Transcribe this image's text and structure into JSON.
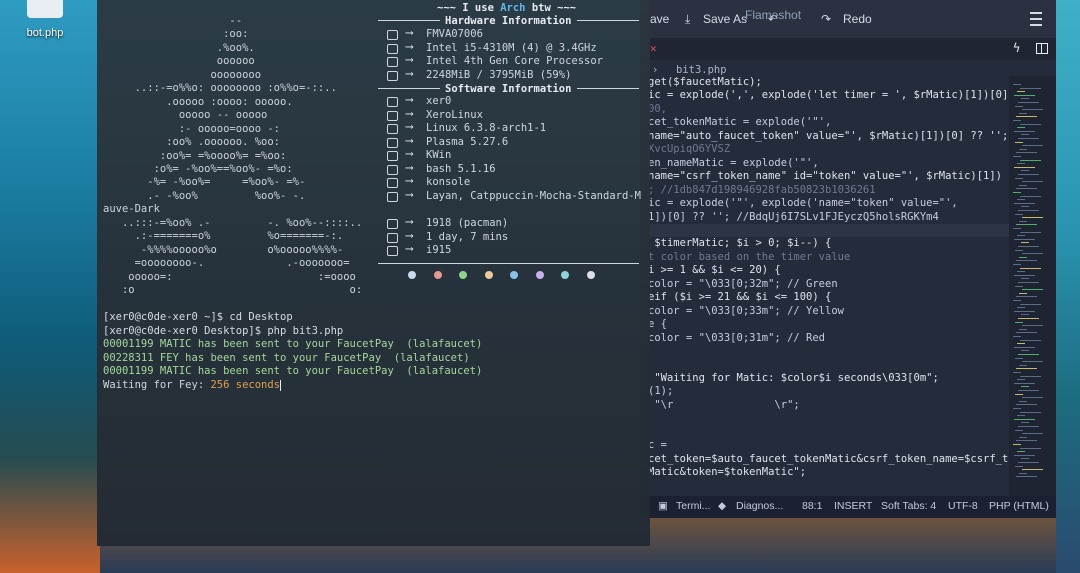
{
  "desktop": {
    "icon_label": "bot.php"
  },
  "editor": {
    "toolbar": {
      "save_partial": "ave",
      "save_as": "Save As",
      "undo_partial": "Flameshot",
      "redo": "Redo"
    },
    "breadcrumb": "bit3.php",
    "code_lines": [
      {
        "text": "get($faucetMatic);",
        "hl": false
      },
      {
        "text": "ic = explode(',', explode('let timer = ', $rMatic)[1])[0]",
        "hl": false
      },
      {
        "text": "00,",
        "hl": false
      },
      {
        "text": "cet_tokenMatic = explode('\"',",
        "hl": false
      },
      {
        "text": "name=\"auto_faucet_token\" value=\"', $rMatic)[1])[0] ?? '';",
        "hl": false
      },
      {
        "text": "XvcUpiqO6YVSZ",
        "hl": false
      },
      {
        "text": "en_nameMatic = explode('\"',",
        "hl": false
      },
      {
        "text": "name=\"csrf_token_name\" id=\"token\" value=\"', $rMatic)[1])",
        "hl": false
      },
      {
        "text": "; //1db847d198946928fab50823b1036261",
        "hl": false
      },
      {
        "text": "ic = explode('\"', explode('name=\"token\" value=\"',",
        "hl": false
      },
      {
        "text": "1])[0] ?? ''; //BdqUj6I7SLv1FJEyczQ5holsRGKYm4",
        "hl": false
      },
      {
        "text": "",
        "hl": true
      },
      {
        "text": " $timerMatic; $i > 0; $i--) {",
        "hl": false
      },
      {
        "text": "t color based on the timer value",
        "hl": false
      },
      {
        "text": "i >= 1 && $i <= 20) {",
        "hl": false
      },
      {
        "text": "color = \"\\033[0;32m\"; // Green",
        "hl": false
      },
      {
        "text": "eif ($i >= 21 && $i <= 100) {",
        "hl": false
      },
      {
        "text": "color = \"\\033[0;33m\"; // Yellow",
        "hl": false
      },
      {
        "text": "e {",
        "hl": false
      },
      {
        "text": "color = \"\\033[0;31m\"; // Red",
        "hl": false
      },
      {
        "text": "",
        "hl": false
      },
      {
        "text": "",
        "hl": false
      },
      {
        "text": " \"Waiting for Matic: $color$i seconds\\033[0m\";",
        "hl": false
      },
      {
        "text": "(1);",
        "hl": false
      },
      {
        "text": " \"\\r                \\r\";",
        "hl": false
      },
      {
        "text": "",
        "hl": false
      },
      {
        "text": "",
        "hl": false
      },
      {
        "text": "c =",
        "hl": false
      },
      {
        "text": "cet_token=$auto_faucet_tokenMatic&csrf_token_name=$csrf_t",
        "hl": false
      },
      {
        "text": "Matic&token=$tokenMatic\";",
        "hl": false
      }
    ],
    "status": {
      "terminal": "Termi...",
      "diagnostics": "Diagnos...",
      "position": "88:1",
      "mode": "INSERT",
      "tabs": "Soft Tabs: 4",
      "encoding": "UTF-8",
      "language": "PHP (HTML)"
    }
  },
  "terminal": {
    "ascii": [
      "                    --",
      "                   :oo:",
      "                  .%oo%.",
      "                  oooooo",
      "                 oooooooo",
      "     ..::-=o%%o: oooooooo :o%%o=-::..",
      "          .ooooo :oooo: ooooo.",
      "            ooooo -- ooooo",
      "            :- ooooo=oooo -:",
      "          :oo% .oooooo. %oo:",
      "         :oo%= =%oooo%= =%oo:",
      "        :o%= -%oo%==%oo%- =%o:",
      "       -%= -%oo%=     =%oo%- =%-",
      "       .- -%oo%         %oo%- -.",
      "auve-Dark",
      "   ..:::-=%oo% .-         -. %oo%--::::..",
      "     .:-=======o%         %o=======-:.",
      "      -%%%%ooooo%o        o%ooooo%%%%-",
      "     =oooooooo-.             .-ooooooo=",
      "    ooooo=:                       :=oooo",
      "   :o                                  o:"
    ],
    "header_tagline_pre": "~~~ I use ",
    "header_tagline_arch": "Arch",
    "header_tagline_post": " btw ~~~",
    "hardware_title": "Hardware Information",
    "software_title": "Software Information",
    "hardware": [
      "FMVA07006",
      "Intel i5-4310M (4) @ 3.4GHz",
      "Intel 4th Gen Core Processor",
      "2248MiB / 3795MiB (59%)"
    ],
    "software": [
      "xer0",
      "XeroLinux",
      "Linux 6.3.8-arch1-1",
      "Plasma 5.27.6",
      "KWin",
      "bash 5.1.16",
      "konsole",
      "Layan, Catppuccin-Mocha-Standard-M"
    ],
    "extra": [
      "1918 (pacman)",
      "1 day, 7 mins",
      "i915"
    ],
    "palette": [
      "#c8dcf0",
      "#e29a92",
      "#8fd48a",
      "#e9c99b",
      "#86c2e6",
      "#c8b0e8",
      "#8fd4d8",
      "#dcdfe8"
    ],
    "lines": [
      {
        "text": "[xer0@c0de-xer0 ~]$ cd Desktop",
        "cls": "prompt"
      },
      {
        "text": "[xer0@c0de-xer0 Desktop]$ php bit3.php",
        "cls": "prompt"
      },
      {
        "text": "00001199 MATIC has been sent to your FaucetPay  (lalafaucet)",
        "cls": "green-txt"
      },
      {
        "text": "00228311 FEY has been sent to your FaucetPay  (lalafaucet)",
        "cls": "green-txt"
      },
      {
        "text": "00001199 MATIC has been sent to your FaucetPay  (lalafaucet)",
        "cls": "green-txt"
      }
    ],
    "waiting_prefix": "Waiting for Fey: ",
    "waiting_seconds": "256 seconds"
  }
}
